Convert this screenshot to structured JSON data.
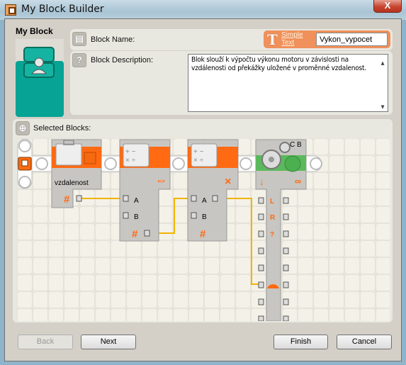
{
  "window": {
    "title": "My Block Builder",
    "close_label": "X"
  },
  "header": {
    "my_block_label": "My Block"
  },
  "block_name": {
    "label": "Block Name:",
    "mode_link": "Simple Text",
    "mode_icon": "T",
    "value": "Vykon_vypocet"
  },
  "block_description": {
    "label": "Block Description:",
    "value": "Blok slouží k výpočtu výkonu motoru v závislosti na vzdálenosti od překážky uložené v proměnné vzdalenost."
  },
  "selected_blocks": {
    "label": "Selected Blocks:",
    "variable_block": {
      "name": "vzdalenost",
      "output": "#"
    },
    "math_block_1": {
      "operation": "−",
      "inputs": [
        "A",
        "B"
      ],
      "output": "#"
    },
    "math_block_2": {
      "operation": "×",
      "inputs": [
        "A",
        "B"
      ],
      "output": "#"
    },
    "motor_block": {
      "ports": "C B",
      "plugs": [
        "L",
        "R",
        "?"
      ]
    },
    "colors": {
      "orange": "#ff6a13",
      "green": "#5cb85c",
      "wire": "#f0b400"
    }
  },
  "buttons": {
    "back": "Back",
    "next": "Next",
    "finish": "Finish",
    "cancel": "Cancel"
  }
}
